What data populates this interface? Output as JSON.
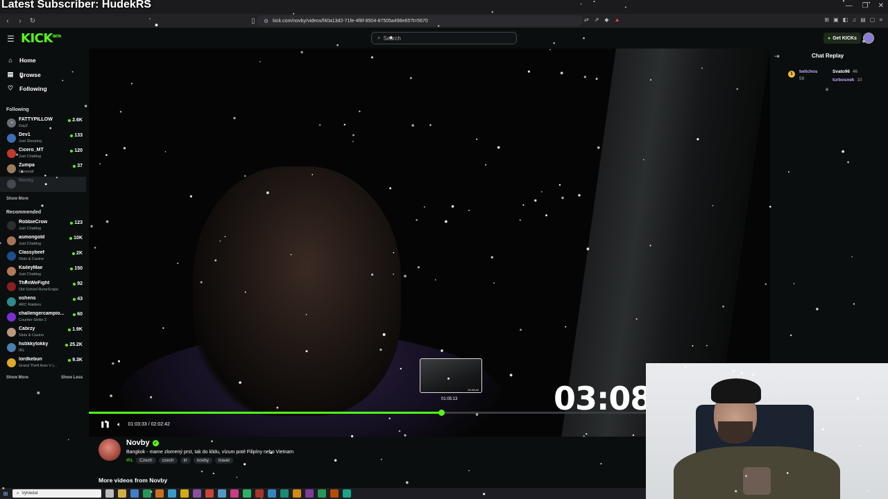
{
  "overlay": {
    "latest_subscriber": "Latest Subscriber: HudekRS"
  },
  "browser": {
    "url": "kick.com/novby/videos/f40a13d2-71fe-4f8f-8504-87505a498e65?t=5670",
    "window_controls": [
      "—",
      "❐",
      "✕"
    ]
  },
  "header": {
    "logo": "KICK",
    "logo_badge": "BETA",
    "search_placeholder": "Search",
    "get_kicks": "Get KICKs"
  },
  "sidebar": {
    "nav": [
      {
        "label": "Home",
        "icon": "home-icon"
      },
      {
        "label": "Browse",
        "icon": "browse-icon"
      },
      {
        "label": "Following",
        "icon": "heart-icon"
      }
    ],
    "following_title": "Following",
    "following": [
      {
        "name": "FATTYPILLOW",
        "category": "DayZ",
        "viewers": "2.6K",
        "color": "#6a6f75"
      },
      {
        "name": "Dev1",
        "category": "Just Sleeping",
        "viewers": "133",
        "color": "#3d6fb5"
      },
      {
        "name": "Cicero_MT",
        "category": "Just Chatting",
        "viewers": "120",
        "color": "#c0392b"
      },
      {
        "name": "Zumpa",
        "category": "Cloverpit",
        "viewers": "37",
        "color": "#9b7b5e"
      },
      {
        "name": "Novby",
        "category": "",
        "viewers": "",
        "color": "#444a50",
        "offline": true
      }
    ],
    "following_show_more": "Show More",
    "recommended_title": "Recommended",
    "recommended": [
      {
        "name": "RobbieCrow",
        "category": "Just Chatting",
        "viewers": "123",
        "color": "#2d2d2d"
      },
      {
        "name": "asmongold",
        "category": "Just Chatting",
        "viewers": "10K",
        "color": "#a5735b"
      },
      {
        "name": "Classybeef",
        "category": "Slots & Casino",
        "viewers": "2K",
        "color": "#1f4e8c"
      },
      {
        "name": "KaileyMae",
        "category": "Just Chatting",
        "viewers": "150",
        "color": "#b57a5c"
      },
      {
        "name": "ThenWeFight",
        "category": "Old School RuneScape",
        "viewers": "92",
        "color": "#8a1f1f"
      },
      {
        "name": "oshens",
        "category": "ARC Raiders",
        "viewers": "43",
        "color": "#2d8b8b"
      },
      {
        "name": "challengercampio...",
        "category": "Counter-Strike 2",
        "viewers": "60",
        "color": "#7a2fd1"
      },
      {
        "name": "Cabrzy",
        "category": "Slots & Casino",
        "viewers": "1.9K",
        "color": "#b89a7a"
      },
      {
        "name": "hstikkytokky",
        "category": "IRL",
        "viewers": "25.2K",
        "color": "#4a7fb0"
      },
      {
        "name": "lordkebun",
        "category": "Grand Theft Auto V (...",
        "viewers": "9.3K",
        "color": "#e0a92a"
      }
    ],
    "show_more": "Show More",
    "show_less": "Show Less"
  },
  "video": {
    "current_time": "01:03:33",
    "separator": "/",
    "duration": "02:02:42",
    "progress": 0.5177,
    "hover_time": "01:05:13",
    "hover_progress": 0.5317,
    "thumb_time": "01:03:42",
    "overlay_timer": "03:08"
  },
  "channel": {
    "name": "Novby",
    "title": "Bangkok - mame zlomený prst, tak do klidu,  vízum poté Filipíny nebo Vietnam",
    "category": "IRL",
    "tags": [
      "Czech",
      "czech",
      "irl",
      "novby",
      "travel"
    ],
    "more_videos": "More videos from Novby"
  },
  "chat": {
    "title": "Chat Replay",
    "rank": "1",
    "gifters": [
      {
        "name": "twitchos",
        "count": "58"
      },
      {
        "name": "Svato96",
        "count": "46"
      },
      {
        "name": "turbosnek",
        "count": "10"
      }
    ]
  },
  "taskbar": {
    "search_placeholder": "Vyhledat",
    "app_colors": [
      "#d7d7d7",
      "#f2c94c",
      "#4a90e2",
      "#27ae60",
      "#e67e22",
      "#3ab0e2",
      "#f1c40f",
      "#9b59b6",
      "#e74c3c",
      "#5dade2",
      "#e84393",
      "#2ecc71",
      "#c0392b",
      "#3498db",
      "#16a085",
      "#f39c12",
      "#8e44ad",
      "#27ae60",
      "#d35400",
      "#1abc9c"
    ]
  }
}
